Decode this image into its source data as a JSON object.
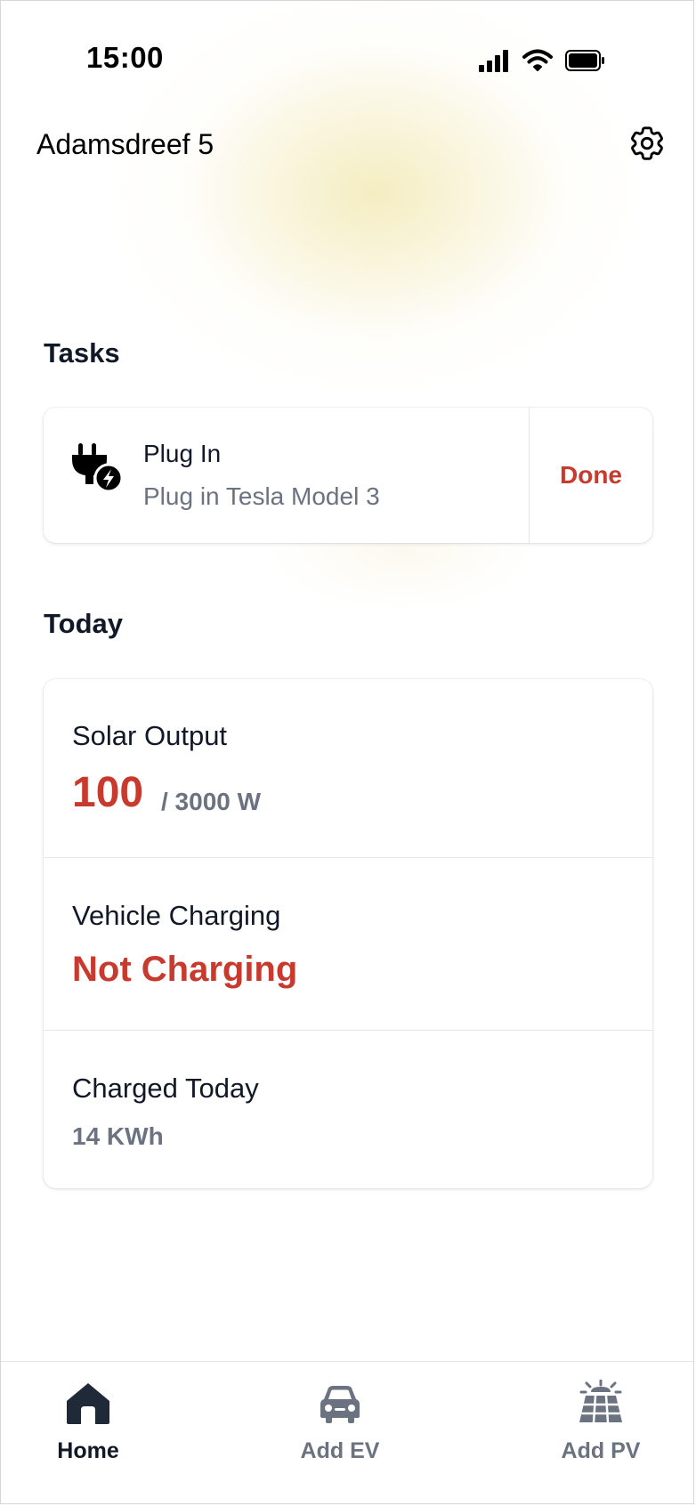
{
  "status_bar": {
    "time": "15:00",
    "icons": [
      "signal-icon",
      "wifi-icon",
      "battery-icon"
    ]
  },
  "header": {
    "title": "Adamsdreef 5",
    "settings_icon": "gear-icon"
  },
  "tasks": {
    "section_title": "Tasks",
    "items": [
      {
        "icon": "plug-bolt-icon",
        "title": "Plug In",
        "subtitle": "Plug in Tesla Model 3",
        "action_label": "Done"
      }
    ]
  },
  "today": {
    "section_title": "Today",
    "solar_output": {
      "label": "Solar Output",
      "value": "100",
      "unit": "/ 3000 W"
    },
    "vehicle_charging": {
      "label": "Vehicle Charging",
      "value": "Not Charging"
    },
    "charged_today": {
      "label": "Charged Today",
      "value": "14 KWh"
    }
  },
  "bottom_nav": {
    "items": [
      {
        "label": "Home",
        "icon": "home-icon",
        "active": true
      },
      {
        "label": "Add EV",
        "icon": "car-icon",
        "active": false
      },
      {
        "label": "Add PV",
        "icon": "solar-panel-icon",
        "active": false
      }
    ]
  },
  "colors": {
    "accent_red": "#c73a2d",
    "text_primary": "#111827",
    "text_secondary": "#6b7280",
    "active_nav": "#1f2937"
  }
}
